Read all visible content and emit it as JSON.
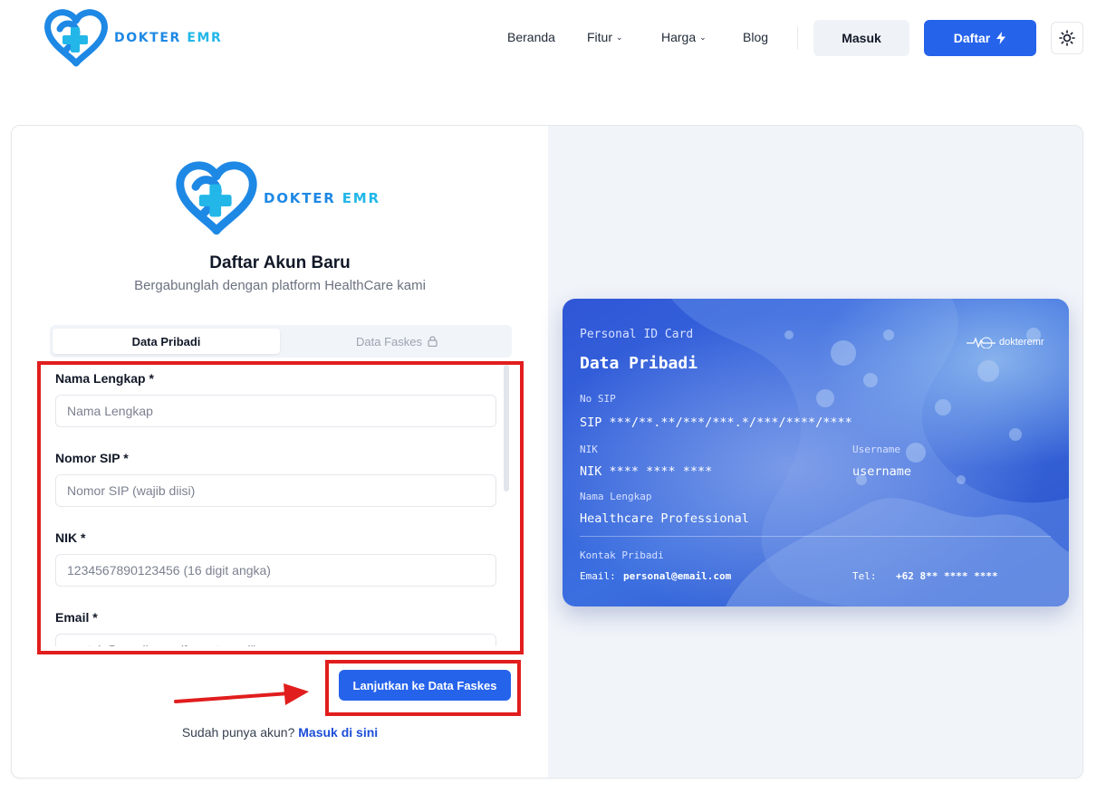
{
  "nav": {
    "brand": {
      "word1": "DOKTER",
      "word2": "EMR"
    },
    "links": [
      "Beranda",
      "Fitur",
      "Harga",
      "Blog"
    ],
    "login_label": "Masuk",
    "register_label": "Daftar"
  },
  "form": {
    "brand": {
      "word1": "DOKTER",
      "word2": "EMR"
    },
    "title": "Daftar Akun Baru",
    "subtitle": "Bergabunglah dengan platform HealthCare kami",
    "tabs": {
      "active": "Data Pribadi",
      "disabled": "Data Faskes"
    },
    "fields": [
      {
        "label": "Nama Lengkap *",
        "placeholder": "Nama Lengkap"
      },
      {
        "label": "Nomor SIP *",
        "placeholder": "Nomor SIP (wajib diisi)"
      },
      {
        "label": "NIK *",
        "placeholder": "1234567890123456 (16 digit angka)"
      },
      {
        "label": "Email *",
        "placeholder": "contoh@email.com (format email)"
      }
    ],
    "next_button": "Lanjutkan ke Data Faskes",
    "footer_text": "Sudah punya akun?",
    "footer_link": "Masuk di sini"
  },
  "id_card": {
    "header": "Personal ID Card",
    "title": "Data Pribadi",
    "logo_text": "dokteremr",
    "sip_label": "No SIP",
    "sip_value": "SIP ***/**.**/***/***.*/***/****/****",
    "nik_label": "NIK",
    "nik_value": "NIK **** **** ****",
    "username_label": "Username",
    "username_value": "username",
    "name_label": "Nama Lengkap",
    "name_value": "Healthcare Professional",
    "contact_label": "Kontak Pribadi",
    "email_label": "Email:",
    "email_value": "personal@email.com",
    "tel_label": "Tel:",
    "tel_value": "+62 8** **** ****"
  },
  "colors": {
    "primary": "#2563EB",
    "brand_blue": "#1E88E5",
    "brand_cyan": "#22B7E8",
    "annotation_red": "#E11D1D"
  }
}
